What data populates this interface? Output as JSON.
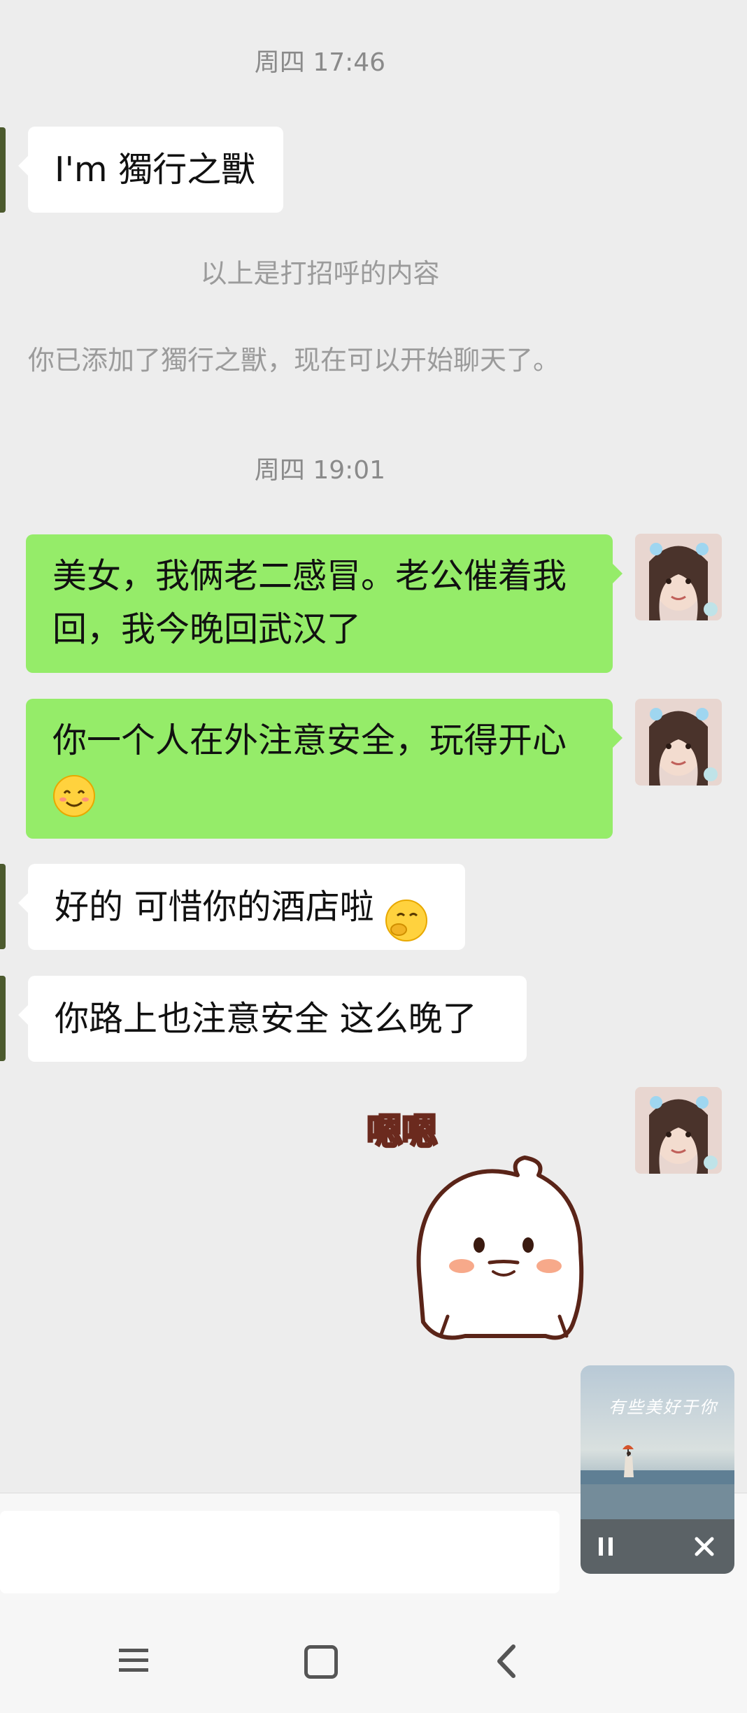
{
  "chat": {
    "time1": "周四 17:46",
    "greeting": "I'm 獨行之獸",
    "greeting_note": "以上是打招呼的内容",
    "added_note": "你已添加了獨行之獸，现在可以开始聊天了。",
    "time2": "周四 19:01",
    "msg_out_1": "美女，我俩老二感冒。老公催着我回，我今晚回武汉了",
    "msg_out_2": "你一个人在外注意安全，玩得开心",
    "msg_in_1": "好的 可惜你的酒店啦",
    "msg_in_2": "你路上也注意安全 这么晚了",
    "sticker_text": "嗯嗯"
  },
  "music_widget": {
    "cover_title": "有些美好于你",
    "pause_icon": "pause-icon",
    "close_icon": "close-icon"
  },
  "navbar": {
    "icons": [
      "menu-icon",
      "home-icon",
      "back-icon"
    ]
  },
  "colors": {
    "background": "#ededed",
    "outgoing_bubble": "#95ec69",
    "incoming_bubble": "#ffffff"
  }
}
